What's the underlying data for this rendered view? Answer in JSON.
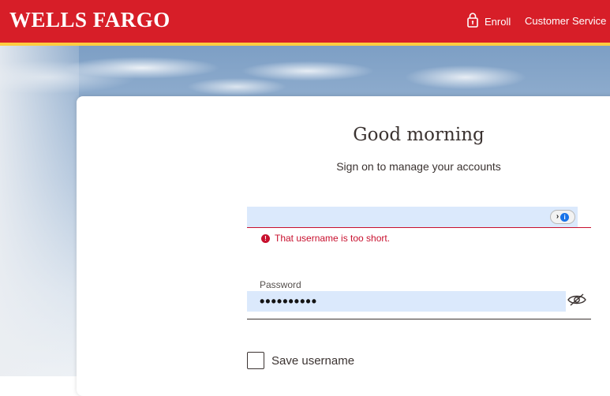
{
  "header": {
    "logo": "WELLS FARGO",
    "enroll_label": "Enroll",
    "customer_service_label": "Customer Service",
    "brand_color": "#d71e28",
    "stripe_color": "#ffcd41"
  },
  "signon": {
    "greeting": "Good morning",
    "subtitle": "Sign on to manage your accounts",
    "username": {
      "value": "",
      "error": "That username is too short."
    },
    "password": {
      "label": "Password",
      "value": "••••••••••"
    },
    "save_username_label": "Save username",
    "error_color": "#c8102e"
  },
  "icons": {
    "enroll": "lock-icon",
    "password_manager": "password-manager-icon",
    "error": "error-icon",
    "eye": "eye-slash-icon"
  }
}
